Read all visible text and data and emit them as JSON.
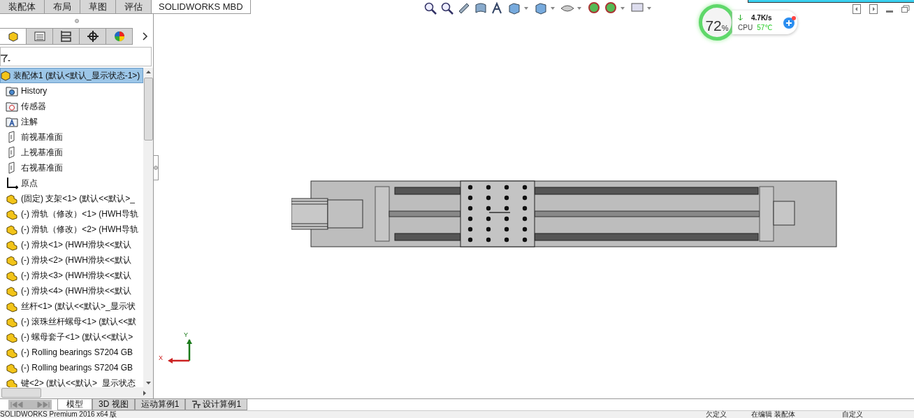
{
  "top_tabs": [
    {
      "label": "装配体",
      "selected": false
    },
    {
      "label": "布局",
      "selected": false
    },
    {
      "label": "草图",
      "selected": false
    },
    {
      "label": "评估",
      "selected": false
    },
    {
      "label": "SOLIDWORKS MBD",
      "selected": true
    }
  ],
  "panel_tabs": [
    {
      "kind": "feature",
      "selected": true
    },
    {
      "kind": "property",
      "selected": false
    },
    {
      "kind": "config",
      "selected": false
    },
    {
      "kind": "dimxpert",
      "selected": false
    },
    {
      "kind": "display",
      "selected": false
    }
  ],
  "tree": {
    "root": {
      "label": "装配体1  (默认<默认_显示状态-1>)",
      "selected": true
    },
    "items": [
      {
        "kind": "history",
        "label": "History"
      },
      {
        "kind": "sensor",
        "label": "传感器"
      },
      {
        "kind": "annotation",
        "label": "注解"
      },
      {
        "kind": "plane",
        "label": "前视基准面"
      },
      {
        "kind": "plane",
        "label": "上视基准面"
      },
      {
        "kind": "plane",
        "label": "右视基准面"
      },
      {
        "kind": "origin",
        "label": "原点"
      },
      {
        "kind": "part",
        "label": "(固定) 支架<1> (默认<<默认>_"
      },
      {
        "kind": "part",
        "label": "(-) 滑轨（修改）<1> (HWH导轨"
      },
      {
        "kind": "part",
        "label": "(-) 滑轨（修改）<2> (HWH导轨"
      },
      {
        "kind": "part",
        "label": "(-) 滑块<1> (HWH滑块<<默认"
      },
      {
        "kind": "part",
        "label": "(-) 滑块<2> (HWH滑块<<默认"
      },
      {
        "kind": "part",
        "label": "(-) 滑块<3> (HWH滑块<<默认"
      },
      {
        "kind": "part",
        "label": "(-) 滑块<4> (HWH滑块<<默认"
      },
      {
        "kind": "part",
        "label": "丝杆<1> (默认<<默认>_显示状"
      },
      {
        "kind": "part",
        "label": "(-) 滚珠丝杆螺母<1> (默认<<默"
      },
      {
        "kind": "part",
        "label": "(-) 螺母套子<1> (默认<<默认>"
      },
      {
        "kind": "part",
        "label": "(-) Rolling bearings S7204 GB"
      },
      {
        "kind": "part",
        "label": "(-) Rolling bearings S7204 GB"
      },
      {
        "kind": "part",
        "label": "键<2> (默认<<默认>_显示状态"
      }
    ]
  },
  "bottom_tabs": [
    {
      "label": "模型",
      "selected": true
    },
    {
      "label": "3D 视图",
      "selected": false
    },
    {
      "label": "运动算例1",
      "selected": false
    },
    {
      "label": "设计算例1",
      "selected": false
    }
  ],
  "monitor": {
    "percent": "72",
    "unit": "%",
    "speed": "4.7K/s",
    "cpu_label": "CPU",
    "temperature": "57℃"
  },
  "axes": {
    "x": "X",
    "y": "Y"
  },
  "status_bar": [
    "SOLIDWORKS Premium 2016 x64 版",
    "欠定义",
    "在编辑 装配体",
    "自定义"
  ]
}
